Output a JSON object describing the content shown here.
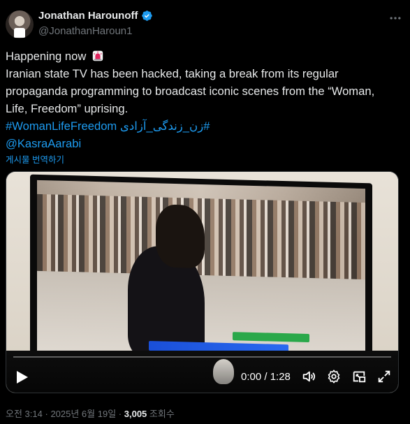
{
  "author": {
    "name": "Jonathan Harounoff",
    "handle": "@JonathanHaroun1"
  },
  "tweet": {
    "line1": "Happening now",
    "line2": "Iranian state TV has been hacked, taking a break from its regular",
    "line3": "propaganda programming to broadcast iconic scenes from the “Woman,",
    "line4": "Life, Freedom” uprising.",
    "hashtag1": "#WomanLifeFreedom",
    "hashtag2": "#زن_زندگی_آزادی",
    "mention": "@KasraAarabi",
    "translate_label": "게시물 번역하기"
  },
  "video": {
    "time": "0:00 / 1:28",
    "progress": 0
  },
  "meta": {
    "time": "오전 3:14",
    "sep1": "·",
    "date": "2025년 6월 19일",
    "sep2": "·",
    "views": "3,005",
    "views_label": "조회수"
  },
  "icons": [
    "verified-badge-icon",
    "more-icon",
    "siren-icon",
    "play-icon",
    "volume-icon",
    "settings-icon",
    "pip-icon",
    "fullscreen-icon"
  ],
  "colors": {
    "accent": "#1d9bf0",
    "text": "#e7e9ea",
    "muted": "#71767b",
    "background": "#000000"
  }
}
